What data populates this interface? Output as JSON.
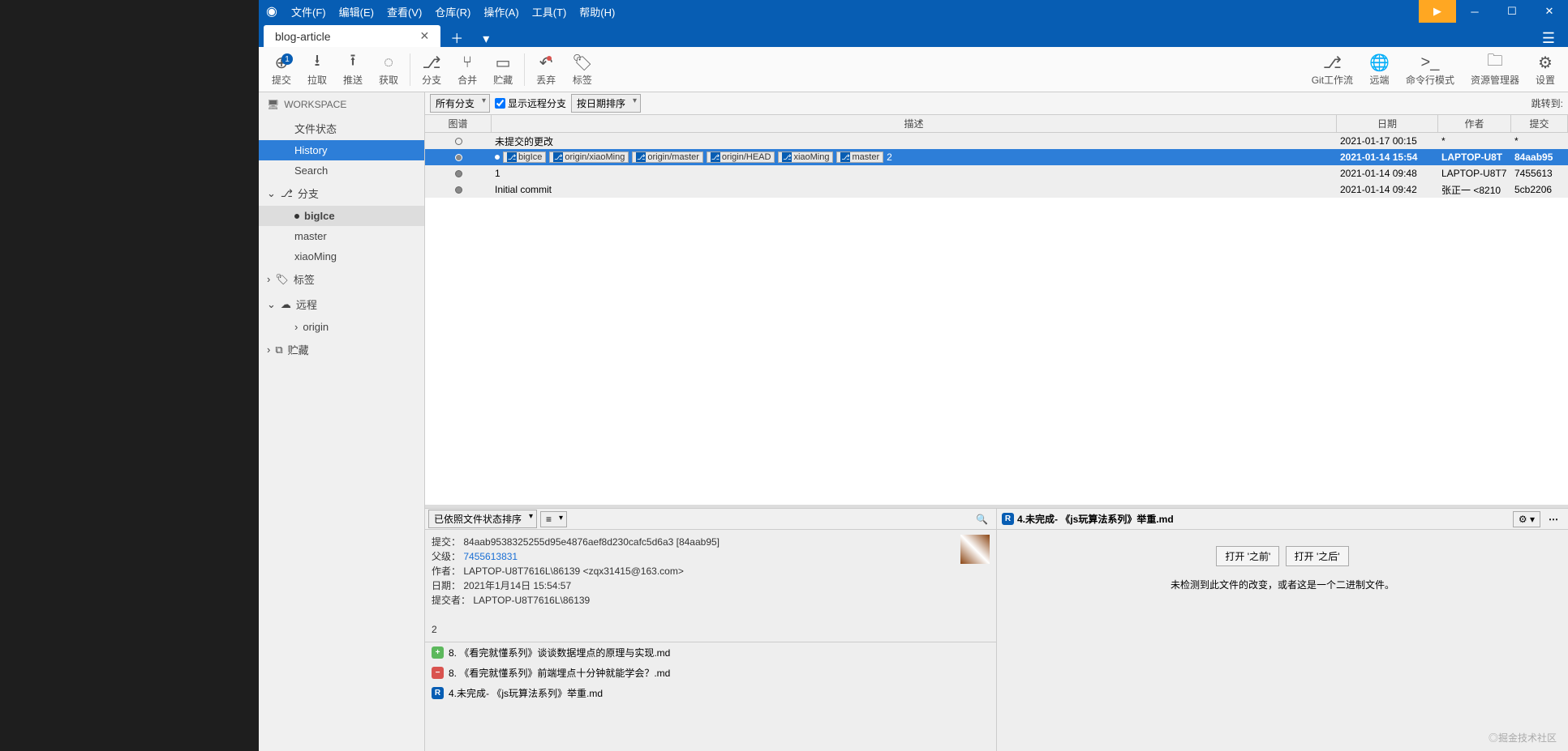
{
  "menubar": [
    "文件(F)",
    "编辑(E)",
    "查看(V)",
    "仓库(R)",
    "操作(A)",
    "工具(T)",
    "帮助(H)"
  ],
  "tab": {
    "name": "blog-article"
  },
  "toolbar": {
    "left": [
      {
        "label": "提交",
        "icon": "⊕",
        "badge": "1"
      },
      {
        "label": "拉取",
        "icon": "⭳"
      },
      {
        "label": "推送",
        "icon": "⭱"
      },
      {
        "label": "获取",
        "icon": "◌"
      },
      {
        "label": "分支",
        "icon": "⎇"
      },
      {
        "label": "合并",
        "icon": "⑂"
      },
      {
        "label": "贮藏",
        "icon": "▭"
      },
      {
        "label": "丢弃",
        "icon": "↶",
        "dot": true
      },
      {
        "label": "标签",
        "icon": "🏷"
      }
    ],
    "right": [
      {
        "label": "Git工作流",
        "icon": "⎇"
      },
      {
        "label": "远端",
        "icon": "🌐"
      },
      {
        "label": "命令行模式",
        "icon": ">_"
      },
      {
        "label": "资源管理器",
        "icon": "🗀"
      },
      {
        "label": "设置",
        "icon": "⚙"
      }
    ]
  },
  "sidebar": {
    "workspace": {
      "title": "WORKSPACE",
      "items": [
        "文件状态",
        "History",
        "Search"
      ],
      "selected": 1
    },
    "branches": {
      "title": "分支",
      "items": [
        "bigIce",
        "master",
        "xiaoMing"
      ],
      "selected": 0
    },
    "tags": {
      "title": "标签"
    },
    "remotes": {
      "title": "远程",
      "items": [
        "origin"
      ]
    },
    "stash": {
      "title": "贮藏"
    }
  },
  "filter": {
    "allBranches": "所有分支",
    "showRemote": "显示远程分支",
    "sortByDate": "按日期排序",
    "jumpTo": "跳转到:"
  },
  "histHeaders": {
    "graph": "图谱",
    "desc": "描述",
    "date": "日期",
    "author": "作者",
    "commit": "提交"
  },
  "commits": [
    {
      "desc": "未提交的更改",
      "date": "2021-01-17 00:15",
      "author": "*",
      "commit": "*",
      "tags": []
    },
    {
      "tags": [
        "bigIce",
        "origin/xiaoMing",
        "origin/master",
        "origin/HEAD",
        "xiaoMing",
        "master"
      ],
      "msg": "2",
      "date": "2021-01-14 15:54",
      "author": "LAPTOP-U8T",
      "commit": "84aab95",
      "selected": true
    },
    {
      "msg": "1",
      "date": "2021-01-14 09:48",
      "author": "LAPTOP-U8T7",
      "commit": "7455613"
    },
    {
      "msg": "Initial commit",
      "date": "2021-01-14 09:42",
      "author": "张正一 <8210",
      "commit": "5cb2206"
    }
  ],
  "detail": {
    "sortLabel": "已依照文件状态排序",
    "commitLabel": "提交：",
    "commitHash": "84aab9538325255d95e4876aef8d230cafc5d6a3 [84aab95]",
    "parentLabel": "父级：",
    "parentHash": "7455613831",
    "authorLabel": "作者：",
    "authorVal": "LAPTOP-U8T7616L\\86139 <zqx31415@163.com>",
    "dateLabel": "日期：",
    "dateVal": "2021年1月14日 15:54:57",
    "committerLabel": "提交者：",
    "committerVal": "LAPTOP-U8T7616L\\86139",
    "message": "2",
    "files": [
      {
        "type": "add",
        "name": "8. 《看完就懂系列》谈谈数据埋点的原理与实现.md"
      },
      {
        "type": "del",
        "name": "8. 《看完就懂系列》前端埋点十分钟就能学会？.md"
      },
      {
        "type": "ren",
        "name": "4.未完成- 《js玩算法系列》举重.md"
      }
    ]
  },
  "diff": {
    "filename": "4.未完成- 《js玩算法系列》举重.md",
    "openBefore": "打开 '之前'",
    "openAfter": "打开 '之后'",
    "noChange": "未检测到此文件的改变，或者这是一个二进制文件。"
  },
  "watermark": "◎掘金技术社区"
}
